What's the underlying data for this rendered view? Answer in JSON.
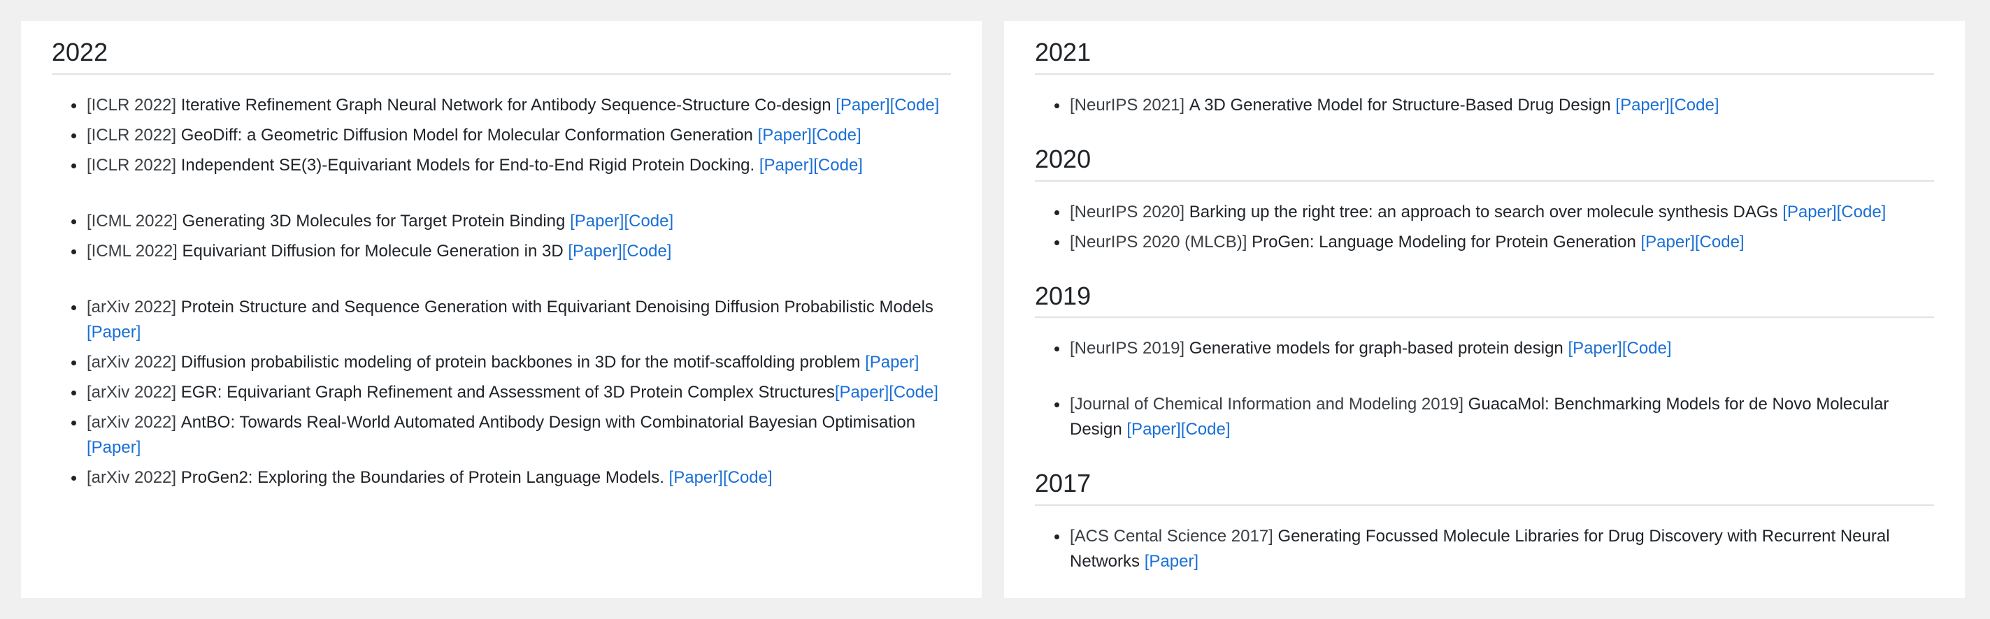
{
  "left": {
    "year": "2022",
    "groups": [
      [
        {
          "venue": "[ICLR 2022]",
          "title": "Iterative Refinement Graph Neural Network for Antibody Sequence-Structure Co-design",
          "sep": " ",
          "links": [
            "[Paper]",
            "[Code]"
          ]
        },
        {
          "venue": "[ICLR 2022]",
          "title": "GeoDiff: a Geometric Diffusion Model for Molecular Conformation Generation",
          "sep": " ",
          "links": [
            "[Paper]",
            "[Code]"
          ]
        },
        {
          "venue": "[ICLR 2022]",
          "title": "Independent SE(3)-Equivariant Models for End-to-End Rigid Protein Docking.",
          "sep": " ",
          "links": [
            "[Paper]",
            "[Code]"
          ]
        }
      ],
      [
        {
          "venue": "[ICML 2022]",
          "title": "Generating 3D Molecules for Target Protein Binding",
          "sep": " ",
          "links": [
            "[Paper]",
            "[Code]"
          ]
        },
        {
          "venue": "[ICML 2022]",
          "title": "Equivariant Diffusion for Molecule Generation in 3D",
          "sep": " ",
          "links": [
            "[Paper]",
            "[Code]"
          ]
        }
      ],
      [
        {
          "venue": "[arXiv 2022]",
          "title": "Protein Structure and Sequence Generation with Equivariant Denoising Diffusion Probabilistic Models",
          "sep": " ",
          "links": [
            "[Paper]"
          ]
        },
        {
          "venue": "[arXiv 2022]",
          "title": "Diffusion probabilistic modeling of protein backbones in 3D for the motif-scaffolding problem",
          "sep": " ",
          "links": [
            "[Paper]"
          ]
        },
        {
          "venue": "[arXiv 2022]",
          "title": "EGR: Equivariant Graph Refinement and Assessment of 3D Protein Complex Structures",
          "sep": "",
          "links": [
            "[Paper]",
            "[Code]"
          ]
        },
        {
          "venue": "[arXiv 2022]",
          "title": "AntBO: Towards Real-World Automated Antibody Design with Combinatorial Bayesian Optimisation",
          "sep": " ",
          "links": [
            "[Paper]"
          ]
        },
        {
          "venue": "[arXiv 2022]",
          "title": "ProGen2: Exploring the Boundaries of Protein Language Models.",
          "sep": " ",
          "links": [
            "[Paper]",
            "[Code]"
          ]
        }
      ]
    ]
  },
  "right": [
    {
      "year": "2021",
      "groups": [
        [
          {
            "venue": "[NeurIPS 2021]",
            "title": "A 3D Generative Model for Structure-Based Drug Design",
            "sep": " ",
            "links": [
              "[Paper]",
              "[Code]"
            ]
          }
        ]
      ]
    },
    {
      "year": "2020",
      "groups": [
        [
          {
            "venue": "[NeurIPS 2020]",
            "title": "Barking up the right tree: an approach to search over molecule synthesis DAGs",
            "sep": " ",
            "links": [
              "[Paper]",
              "[Code]"
            ]
          },
          {
            "venue": "[NeurIPS 2020 (MLCB)]",
            "title": "ProGen: Language Modeling for Protein Generation",
            "sep": " ",
            "links": [
              "[Paper]",
              "[Code]"
            ]
          }
        ]
      ]
    },
    {
      "year": "2019",
      "groups": [
        [
          {
            "venue": "[NeurIPS 2019]",
            "title": "Generative models for graph-based protein design",
            "sep": " ",
            "links": [
              "[Paper]",
              "[Code]"
            ]
          }
        ],
        [
          {
            "venue": "[Journal of Chemical Information and Modeling 2019]",
            "title": "GuacaMol: Benchmarking Models for de Novo Molecular Design",
            "sep": " ",
            "links": [
              "[Paper]",
              "[Code]"
            ]
          }
        ]
      ]
    },
    {
      "year": "2017",
      "groups": [
        [
          {
            "venue": "[ACS Cental Science 2017]",
            "title": "Generating Focussed Molecule Libraries for Drug Discovery with Recurrent Neural Networks",
            "sep": " ",
            "links": [
              "[Paper]"
            ]
          }
        ]
      ]
    }
  ],
  "colors": {
    "link": "#1a6fd6",
    "background": "#f0f0f0",
    "panel": "#ffffff",
    "rule": "#dfe2e5"
  }
}
